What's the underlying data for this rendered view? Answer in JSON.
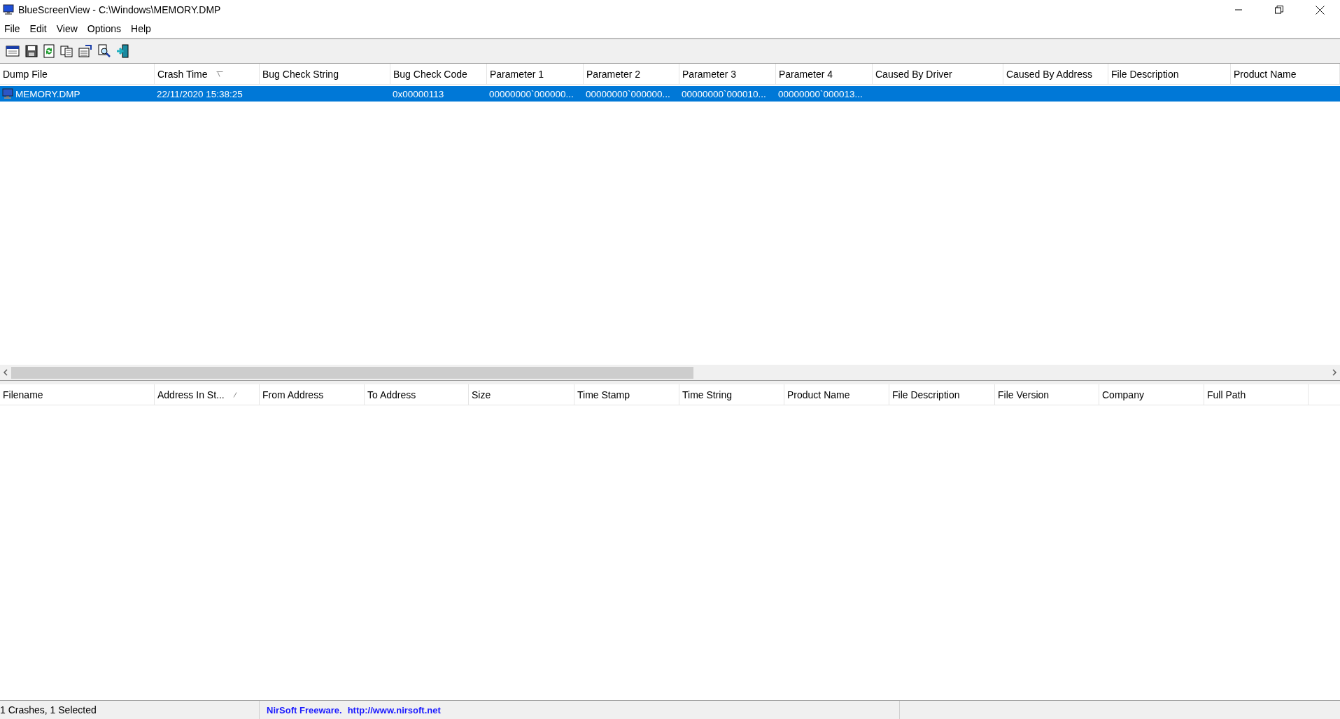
{
  "window": {
    "title": "BlueScreenView  -  C:\\Windows\\MEMORY.DMP"
  },
  "menu": [
    "File",
    "Edit",
    "View",
    "Options",
    "Help"
  ],
  "crash_table": {
    "columns": [
      {
        "label": "Dump File",
        "sorted": false
      },
      {
        "label": "Crash Time",
        "sorted": true
      },
      {
        "label": "Bug Check String",
        "sorted": false
      },
      {
        "label": "Bug Check Code",
        "sorted": false
      },
      {
        "label": "Parameter 1",
        "sorted": false
      },
      {
        "label": "Parameter 2",
        "sorted": false
      },
      {
        "label": "Parameter 3",
        "sorted": false
      },
      {
        "label": "Parameter 4",
        "sorted": false
      },
      {
        "label": "Caused By Driver",
        "sorted": false
      },
      {
        "label": "Caused By Address",
        "sorted": false
      },
      {
        "label": "File Description",
        "sorted": false
      },
      {
        "label": "Product Name",
        "sorted": false
      }
    ],
    "rows": [
      {
        "selected": true,
        "cells": [
          "MEMORY.DMP",
          "22/11/2020 15:38:25",
          "",
          "0x00000113",
          "00000000`000000...",
          "00000000`000000...",
          "00000000`000010...",
          "00000000`000013...",
          "",
          "",
          "",
          ""
        ]
      }
    ]
  },
  "driver_table": {
    "columns": [
      {
        "label": "Filename",
        "sorted": false
      },
      {
        "label": "Address In St...",
        "sorted": true
      },
      {
        "label": "From Address",
        "sorted": false
      },
      {
        "label": "To Address",
        "sorted": false
      },
      {
        "label": "Size",
        "sorted": false
      },
      {
        "label": "Time Stamp",
        "sorted": false
      },
      {
        "label": "Time String",
        "sorted": false
      },
      {
        "label": "Product Name",
        "sorted": false
      },
      {
        "label": "File Description",
        "sorted": false
      },
      {
        "label": "File Version",
        "sorted": false
      },
      {
        "label": "Company",
        "sorted": false
      },
      {
        "label": "Full Path",
        "sorted": false
      }
    ]
  },
  "status_bar": {
    "count": "1 Crashes, 1 Selected",
    "vendor": "NirSoft Freeware.",
    "link": "http://www.nirsoft.net"
  }
}
